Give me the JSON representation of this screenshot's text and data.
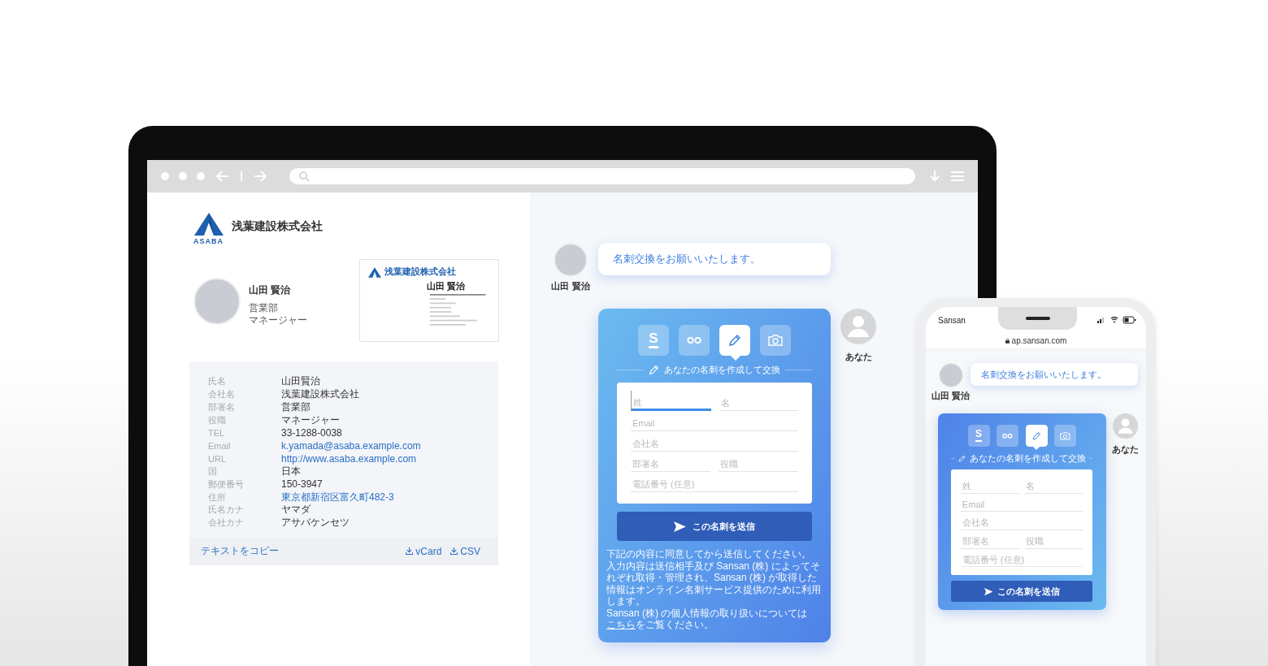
{
  "company": {
    "logo_text": "ASABA",
    "name": "浅葉建設株式会社"
  },
  "profile": {
    "name": "山田 賢治",
    "department": "営業部",
    "title": "マネージャー"
  },
  "business_card": {
    "company": "浅葉建設株式会社",
    "name": "山田 賢治"
  },
  "details": {
    "rows": [
      {
        "label": "氏名",
        "value": "山田賢治",
        "kind": "text"
      },
      {
        "label": "会社名",
        "value": "浅葉建設株式会社",
        "kind": "text"
      },
      {
        "label": "部署名",
        "value": "営業部",
        "kind": "text"
      },
      {
        "label": "役職",
        "value": "マネージャー",
        "kind": "text"
      },
      {
        "label": "TEL",
        "value": "33-1288-0038",
        "kind": "text"
      },
      {
        "label": "Email",
        "value": "k.yamada@asaba.example.com",
        "kind": "link"
      },
      {
        "label": "URL",
        "value": "http://www.asaba.example.com",
        "kind": "link"
      },
      {
        "label": "国",
        "value": "日本",
        "kind": "text"
      },
      {
        "label": "郵便番号",
        "value": "150-3947",
        "kind": "text"
      },
      {
        "label": "住所",
        "value": "東京都新宿区富久町482-3",
        "kind": "link"
      },
      {
        "label": "氏名カナ",
        "value": "ヤマダ",
        "kind": "text"
      },
      {
        "label": "会社カナ",
        "value": "アサバケンセツ",
        "kind": "text"
      }
    ],
    "copy_link": "テキストをコピー",
    "downloads": [
      "vCard",
      "CSV"
    ]
  },
  "laptop": {
    "chat": {
      "sender": "山田 賢治",
      "message": "名刺交換をお願いいたします。",
      "recipient": "あなた",
      "tabs": [
        {
          "kind": "sansan",
          "glyph": "S",
          "selected": false
        },
        {
          "kind": "link",
          "selected": false
        },
        {
          "kind": "pen",
          "selected": true
        },
        {
          "kind": "camera",
          "selected": false
        }
      ],
      "form_title": "あなたの名刺を作成して交換",
      "field_rows": [
        {
          "fields": [
            {
              "placeholder": "姓",
              "focused": true
            },
            {
              "placeholder": "名",
              "focused": false
            }
          ]
        },
        {
          "fields": [
            {
              "placeholder": "Email",
              "focused": false
            }
          ]
        },
        {
          "fields": [
            {
              "placeholder": "会社名",
              "focused": false
            }
          ]
        },
        {
          "fields": [
            {
              "placeholder": "部署名",
              "focused": false
            },
            {
              "placeholder": "役職",
              "focused": false
            }
          ]
        },
        {
          "fields": [
            {
              "placeholder": "電話番号 (任意)",
              "focused": false
            }
          ]
        }
      ],
      "submit": "この名刺を送信",
      "notice": {
        "lines": [
          "下記の内容に同意してから送信してください。",
          "入力内容は送信相手及び Sansan (株) によってそれぞれ取得・管理され、Sansan (株) が取得した情報はオンライン名刺サービス提供のために利用します。"
        ],
        "before_link": "Sansan (株) の個人情報の取り扱いについては",
        "link": "こちら",
        "after_link": "をご覧ください。"
      }
    }
  },
  "phone": {
    "carrier": "Sansan",
    "url": "ap.sansan.com",
    "chat": {
      "sender": "山田 賢治",
      "message": "名刺交換をお願いいたします。",
      "recipient": "あなた",
      "tabs": [
        {
          "kind": "sansan",
          "glyph": "S",
          "selected": false
        },
        {
          "kind": "link",
          "selected": false
        },
        {
          "kind": "pen",
          "selected": true
        },
        {
          "kind": "camera",
          "selected": false
        }
      ],
      "form_title": "あなたの名刺を作成して交換",
      "field_rows": [
        {
          "fields": [
            {
              "placeholder": "姓",
              "focused": false
            },
            {
              "placeholder": "名",
              "focused": false
            }
          ]
        },
        {
          "fields": [
            {
              "placeholder": "Email",
              "focused": false
            }
          ]
        },
        {
          "fields": [
            {
              "placeholder": "会社名",
              "focused": false
            }
          ]
        },
        {
          "fields": [
            {
              "placeholder": "部署名",
              "focused": false
            },
            {
              "placeholder": "役職",
              "focused": false
            }
          ]
        },
        {
          "fields": [
            {
              "placeholder": "電話番号 (任意)",
              "focused": false
            }
          ]
        }
      ],
      "submit": "この名刺を送信"
    }
  }
}
